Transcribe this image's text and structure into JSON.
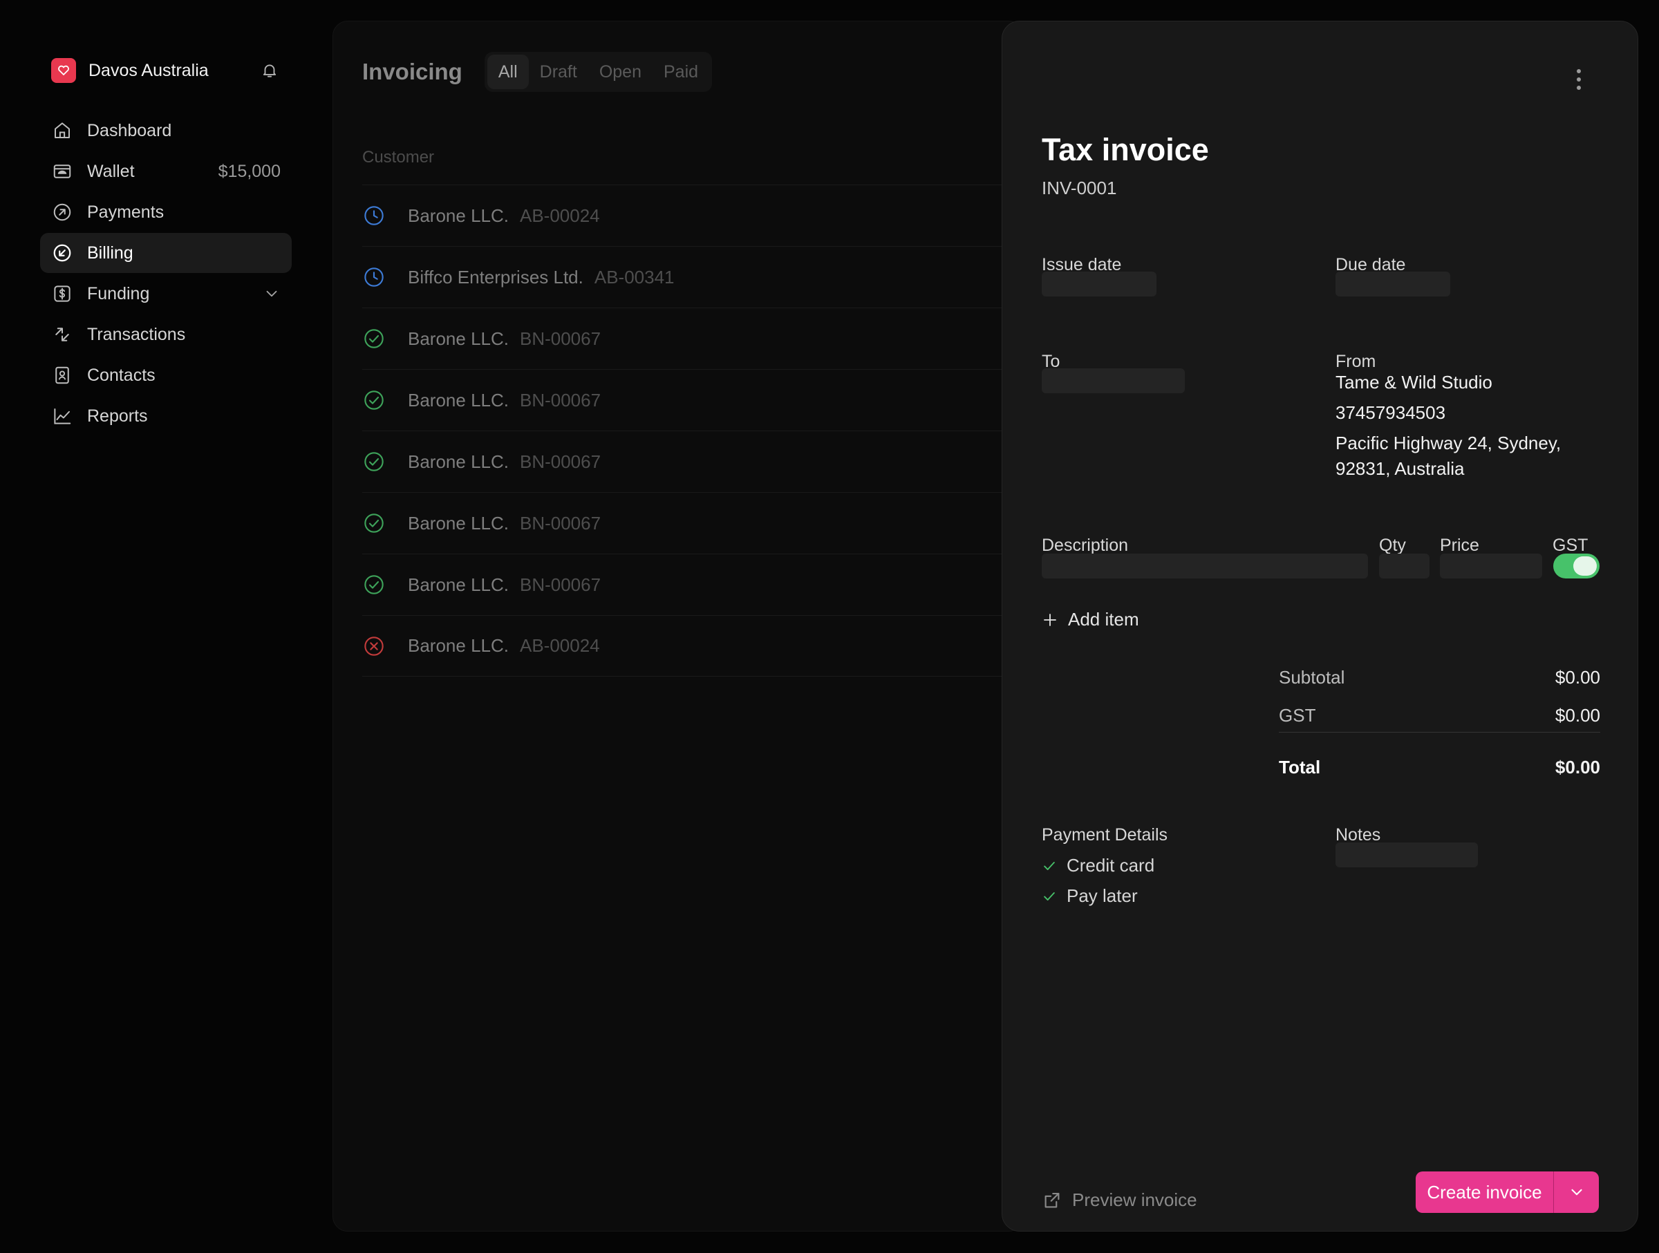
{
  "sidebar": {
    "org_name": "Davos Australia",
    "items": [
      {
        "label": "Dashboard",
        "icon": "home-icon"
      },
      {
        "label": "Wallet",
        "icon": "wallet-icon",
        "value": "$15,000"
      },
      {
        "label": "Payments",
        "icon": "arrow-up-right-circle-icon"
      },
      {
        "label": "Billing",
        "icon": "arrow-down-left-circle-icon",
        "active": true
      },
      {
        "label": "Funding",
        "icon": "dollar-square-icon",
        "expandable": true
      },
      {
        "label": "Transactions",
        "icon": "transfer-arrows-icon"
      },
      {
        "label": "Contacts",
        "icon": "contact-book-icon"
      },
      {
        "label": "Reports",
        "icon": "line-chart-icon"
      }
    ]
  },
  "list": {
    "title": "Invoicing",
    "filters": [
      "All",
      "Draft",
      "Open",
      "Paid"
    ],
    "active_filter": "All",
    "column_header": "Customer",
    "rows": [
      {
        "status": "pending",
        "name": "Barone LLC.",
        "code": "AB-00024"
      },
      {
        "status": "pending",
        "name": "Biffco Enterprises Ltd.",
        "code": "AB-00341"
      },
      {
        "status": "paid",
        "name": "Barone LLC.",
        "code": "BN-00067"
      },
      {
        "status": "paid",
        "name": "Barone LLC.",
        "code": "BN-00067"
      },
      {
        "status": "paid",
        "name": "Barone LLC.",
        "code": "BN-00067"
      },
      {
        "status": "paid",
        "name": "Barone LLC.",
        "code": "BN-00067"
      },
      {
        "status": "paid",
        "name": "Barone LLC.",
        "code": "BN-00067"
      },
      {
        "status": "failed",
        "name": "Barone LLC.",
        "code": "AB-00024"
      }
    ]
  },
  "invoice": {
    "title": "Tax invoice",
    "number": "INV-0001",
    "issue_date_label": "Issue date",
    "due_date_label": "Due date",
    "to_label": "To",
    "from_label": "From",
    "from_name": "Tame & Wild Studio",
    "from_abn": "37457934503",
    "from_address_line1": "Pacific Highway 24, Sydney,",
    "from_address_line2": "92831, Australia",
    "columns": {
      "description": "Description",
      "qty": "Qty",
      "price": "Price",
      "gst": "GST"
    },
    "gst_enabled": true,
    "add_item_label": "Add item",
    "subtotal_label": "Subtotal",
    "subtotal": "$0.00",
    "gst_label": "GST",
    "gst_amount": "$0.00",
    "total_label": "Total",
    "total": "$0.00",
    "payment_details_label": "Payment Details",
    "payment_methods": [
      "Credit card",
      "Pay later"
    ],
    "notes_label": "Notes",
    "preview_label": "Preview invoice",
    "create_label": "Create invoice"
  },
  "colors": {
    "accent": "#e8378f",
    "toggle_on": "#47c26a",
    "status_pending": "#3d7bd6",
    "status_paid": "#3ea35a",
    "status_failed": "#c23b3b",
    "brand": "#e8384f"
  }
}
